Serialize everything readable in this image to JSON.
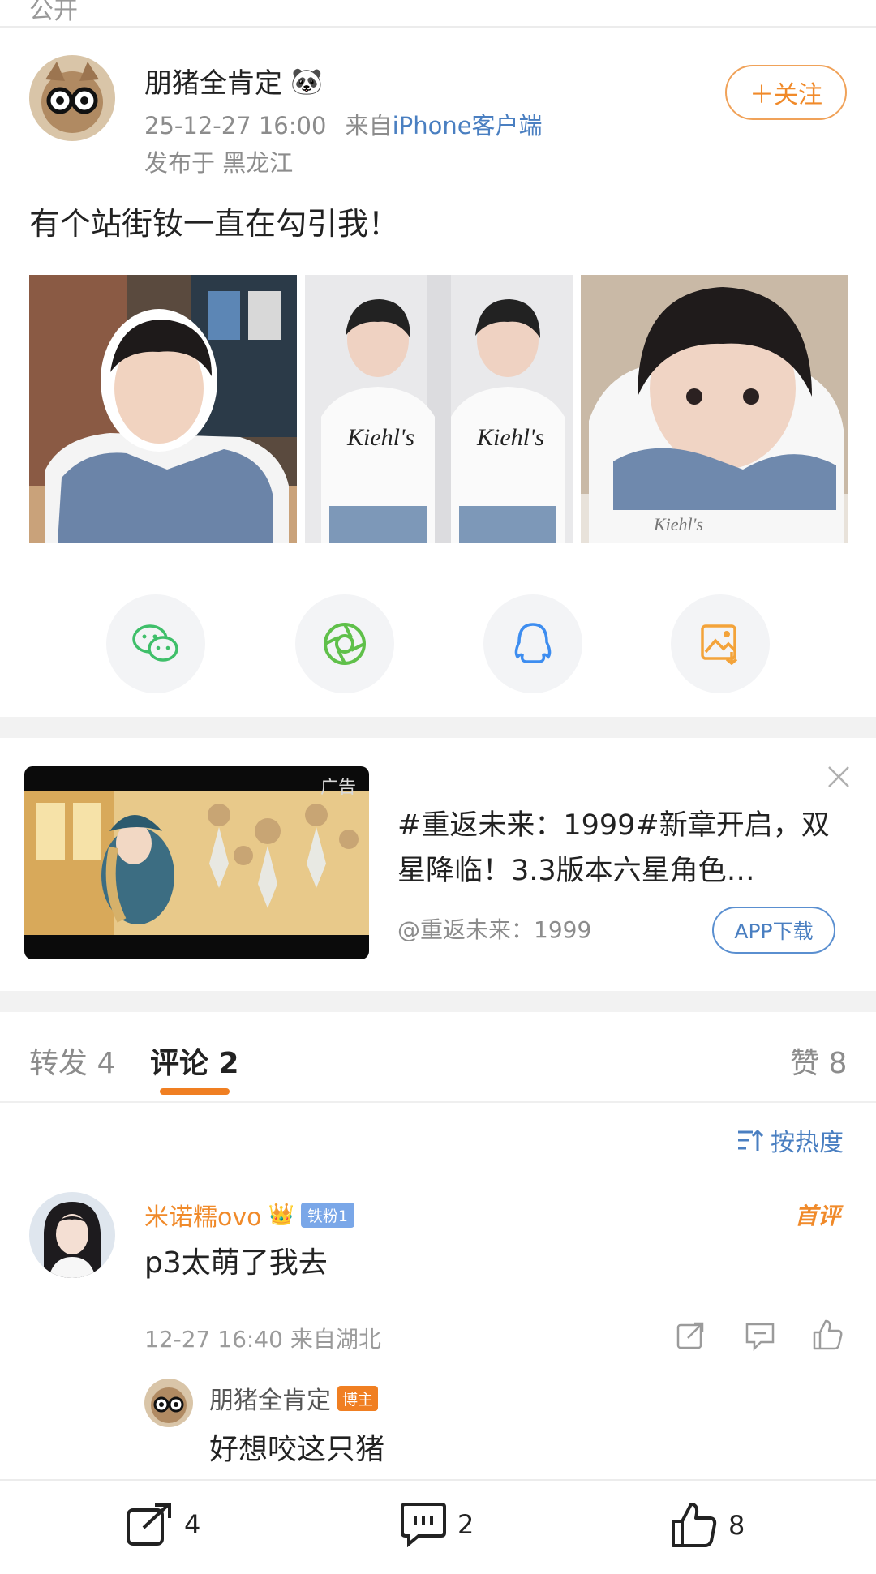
{
  "top": {
    "cut_text": "公开"
  },
  "post": {
    "author": "朋猪全肯定",
    "author_emoji": "🐼",
    "time": "25-12-27 16:00",
    "source_prefix": "来自",
    "source": "iPhone客户端",
    "location": "发布于 黑龙江",
    "follow_label": "＋关注",
    "text": "有个站街钕一直在勾引我！",
    "photos": [
      "Kiehl's standee 1",
      "Kiehl's standee 2",
      "Kiehl's standee 3"
    ]
  },
  "share": {
    "icons": [
      "wechat-icon",
      "moments-icon",
      "qq-icon",
      "save-image-icon"
    ]
  },
  "ad": {
    "tag": "广告",
    "title": "#重返未来：1999#新章开启，双星降临！3.3版本六星角色…",
    "account": "@重返未来：1999",
    "button": "APP下载"
  },
  "tabs": {
    "repost": "转发 4",
    "comment": "评论 2",
    "like": "赞 8"
  },
  "sort_label": "按热度",
  "comments": [
    {
      "name": "米诺糯ovo",
      "badge": "铁粉1",
      "tag": "首评",
      "text": "p3太萌了我去",
      "meta": "12-27 16:40 来自湖北",
      "reply": {
        "name": "朋猪全肯定",
        "badge": "博主",
        "text": "好想咬这只猪"
      }
    }
  ],
  "bottom_bar": {
    "repost_count": "4",
    "comment_count": "2",
    "like_count": "8"
  },
  "colors": {
    "accent_orange": "#f08a2a",
    "link_blue": "#4a7fc1",
    "separator": "#f2f2f2"
  }
}
